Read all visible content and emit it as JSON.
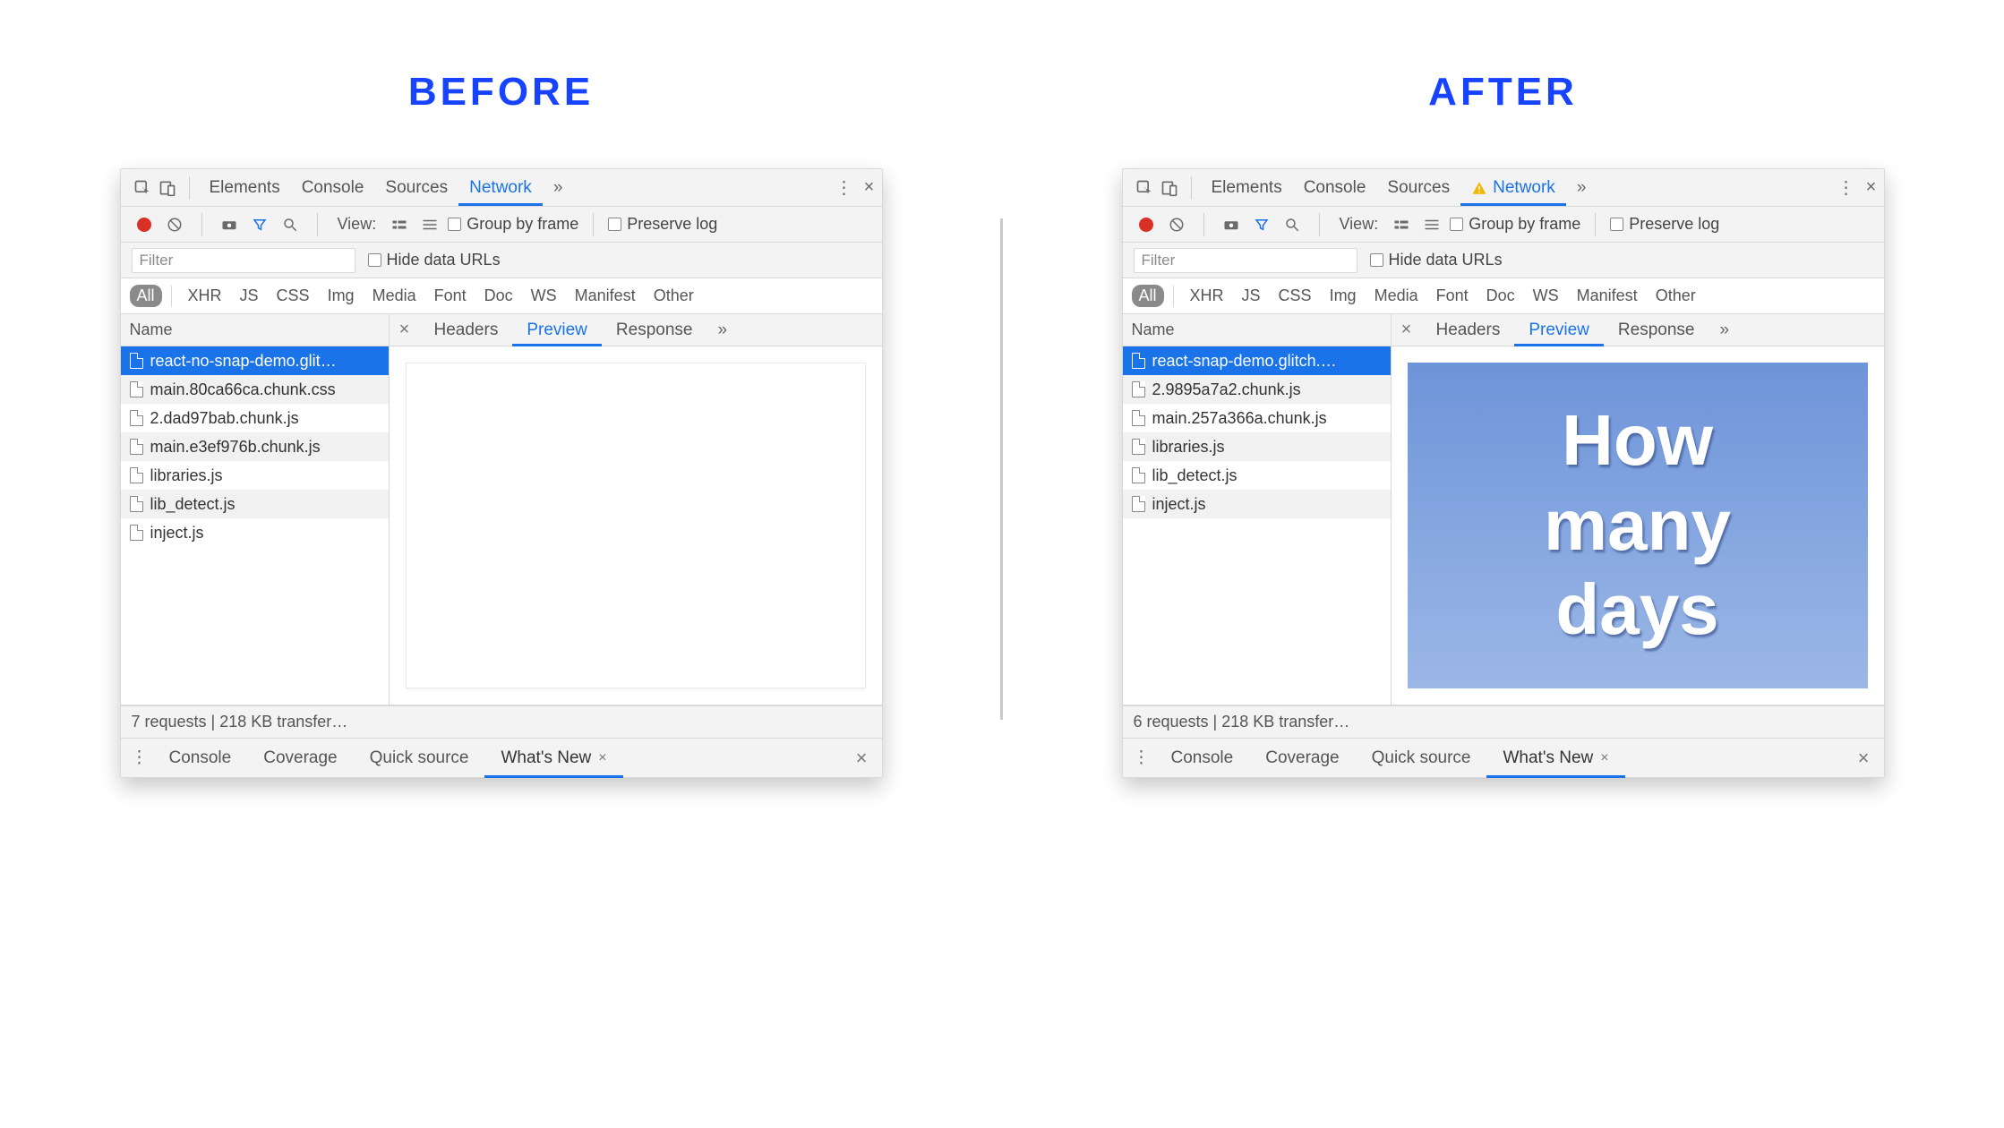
{
  "titles": {
    "before": "BEFORE",
    "after": "AFTER"
  },
  "topTabs": {
    "elements": "Elements",
    "console": "Console",
    "sources": "Sources",
    "network": "Network"
  },
  "toolbar2": {
    "viewLabel": "View:",
    "groupByFrame": "Group by frame",
    "preserveLog": "Preserve log"
  },
  "toolbar3": {
    "filterPlaceholder": "Filter",
    "hideDataUrls": "Hide data URLs"
  },
  "xhrFilters": [
    "All",
    "XHR",
    "JS",
    "CSS",
    "Img",
    "Media",
    "Font",
    "Doc",
    "WS",
    "Manifest",
    "Other"
  ],
  "listHeader": "Name",
  "detailTabs": {
    "headers": "Headers",
    "preview": "Preview",
    "response": "Response"
  },
  "drawerTabs": {
    "console": "Console",
    "coverage": "Coverage",
    "quickSource": "Quick source",
    "whatsNew": "What's New"
  },
  "before": {
    "networkHasWarning": false,
    "requests": [
      "react-no-snap-demo.glit…",
      "main.80ca66ca.chunk.css",
      "2.dad97bab.chunk.js",
      "main.e3ef976b.chunk.js",
      "libraries.js",
      "lib_detect.js",
      "inject.js"
    ],
    "status": "7 requests | 218 KB transfer…",
    "previewMode": "empty"
  },
  "after": {
    "networkHasWarning": true,
    "requests": [
      "react-snap-demo.glitch.…",
      "2.9895a7a2.chunk.js",
      "main.257a366a.chunk.js",
      "libraries.js",
      "lib_detect.js",
      "inject.js"
    ],
    "status": "6 requests | 218 KB transfer…",
    "previewMode": "card",
    "previewLines": [
      "How",
      "many",
      "days"
    ]
  }
}
